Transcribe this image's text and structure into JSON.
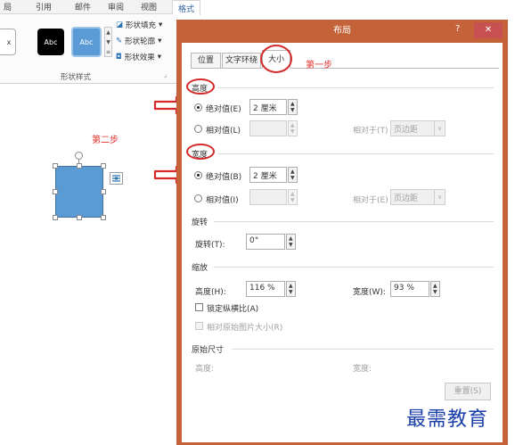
{
  "ribbon": {
    "tabs": [
      "局",
      "引用",
      "邮件",
      "审阅",
      "视图"
    ],
    "active_tab": "格式",
    "style_swatches": [
      "Abc",
      "Abc"
    ],
    "buttons": [
      "形状填充",
      "形状轮廓",
      "形状效果"
    ],
    "group_label": "形状样式"
  },
  "canvas": {
    "step_label": "第二步"
  },
  "dialog": {
    "title": "布局",
    "help": "?",
    "close": "✕",
    "tabs": [
      "位置",
      "文字环绕",
      "大小"
    ],
    "active_tab": "大小",
    "step_label": "第一步",
    "height_section": {
      "title": "高度",
      "absolute_label": "绝对值(E)",
      "absolute_value": "2 厘米",
      "relative_label": "相对值(L)",
      "relative_to_label": "相对于(T)",
      "relative_to_value": "页边距"
    },
    "width_section": {
      "title": "宽度",
      "absolute_label": "绝对值(B)",
      "absolute_value": "2 厘米",
      "relative_label": "相对值(I)",
      "relative_to_label": "相对于(E)",
      "relative_to_value": "页边距"
    },
    "rotate_section": {
      "title": "旋转",
      "rotation_label": "旋转(T):",
      "rotation_value": "0°"
    },
    "scale_section": {
      "title": "缩放",
      "height_label": "高度(H):",
      "height_value": "116 %",
      "width_label": "宽度(W):",
      "width_value": "93 %",
      "lock_aspect_label": "锁定纵横比(A)",
      "relative_original_label": "相对原始图片大小(R)"
    },
    "original_section": {
      "title": "原始尺寸",
      "height_label": "高度:",
      "width_label": "宽度:"
    },
    "reset_button": "重置(S)"
  },
  "watermark": "最需教育",
  "colors": {
    "dialog_frame": "#c4623a",
    "annotation_red": "#d42a2a",
    "shape_fill": "#5b9bd5"
  }
}
